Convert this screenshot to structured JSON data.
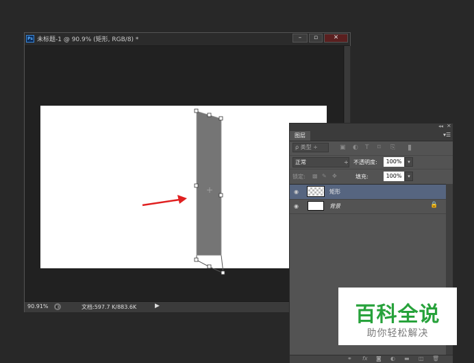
{
  "document_window": {
    "app_icon": "Ps",
    "title": "未标题-1 @ 90.9% (矩形, RGB/8) *",
    "controls": {
      "minimize": "–",
      "maximize": "▫",
      "close": "✕"
    },
    "status": {
      "zoom": "90.91%",
      "doc_size": "文档:597.7 K/883.6K",
      "arrow": "▶"
    }
  },
  "layers_panel": {
    "tab_label": "图层",
    "collapse_icon": "◂◂",
    "close_icon": "✕",
    "menu_icon": "▾☰",
    "filter": {
      "label": "ρ 类型  ÷",
      "icons": [
        "image-filter-icon",
        "adjustment-filter-icon",
        "type-filter-icon",
        "shape-filter-icon",
        "smart-object-filter-icon",
        "filter-toggle-icon"
      ]
    },
    "blend_mode": "正常",
    "blend_chevron": "÷",
    "opacity_label": "不透明度:",
    "opacity_value": "100%",
    "lock_label": "锁定:",
    "fill_label": "填充:",
    "fill_value": "100%",
    "dropdown_glyph": "▾",
    "layers": [
      {
        "name": "矩形",
        "selected": true,
        "thumbnail": "transparency",
        "visible": true
      },
      {
        "name": "背景",
        "selected": false,
        "thumbnail": "white",
        "visible": true,
        "locked": true
      }
    ],
    "bottom_icons": [
      "link-icon",
      "fx-icon",
      "mask-icon",
      "adjustment-icon",
      "group-icon",
      "new-layer-icon",
      "delete-icon"
    ]
  },
  "colors": {
    "selected_layer": "#566580",
    "shape_fill": "#757575",
    "arrow": "#e02020",
    "watermark_green": "#27a23b"
  },
  "watermark": {
    "title": "百科全说",
    "subtitle": "助你轻松解决"
  }
}
